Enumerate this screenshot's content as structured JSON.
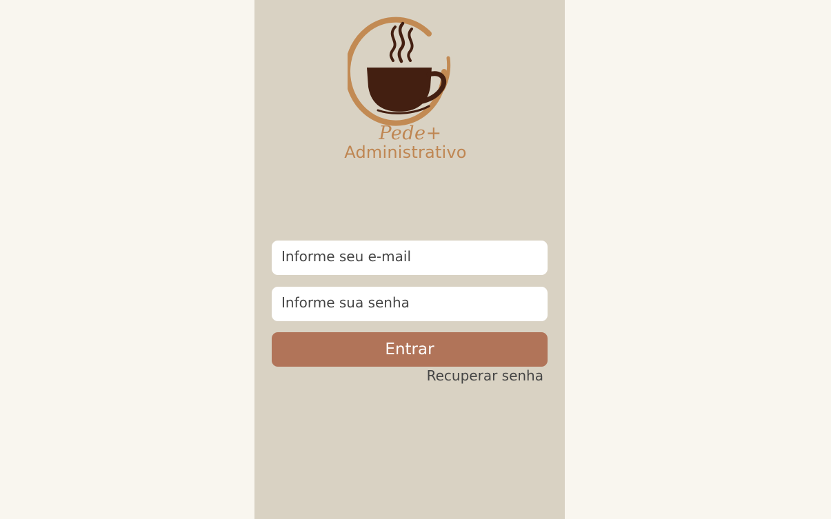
{
  "brand": {
    "name": "Pede+",
    "subtitle": "Administrativo",
    "logo_icon": "coffee-cup-icon",
    "color": "#bf8652"
  },
  "login": {
    "email_placeholder": "Informe seu e-mail",
    "email_value": "",
    "password_placeholder": "Informe sua senha",
    "password_value": "",
    "submit_label": "Entrar",
    "recover_label": "Recuperar senha"
  },
  "colors": {
    "page_background": "#f9f6ef",
    "panel_background": "#d9d2c3",
    "button": "#b17459",
    "cup": "#431f11"
  }
}
